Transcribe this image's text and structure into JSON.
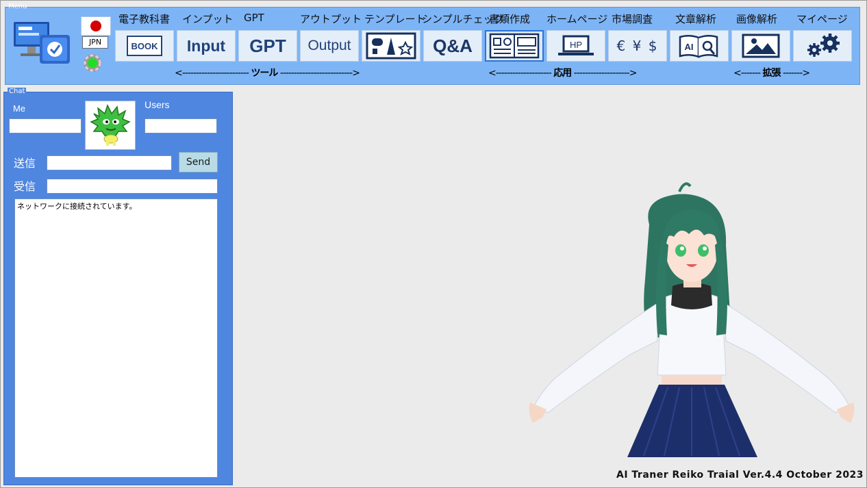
{
  "menu": {
    "group_title": "Menu",
    "language_button": "JPN",
    "tabs": [
      {
        "label": "電子教科書",
        "button": "BOOK",
        "icon": "book-icon"
      },
      {
        "label": "インプット",
        "button": "Input",
        "icon": "input-icon"
      },
      {
        "label": "GPT",
        "button": "GPT",
        "icon": "gpt-icon"
      },
      {
        "label": "アウトプット",
        "button": "Output",
        "icon": "output-icon"
      },
      {
        "label": "テンプレート",
        "button": "",
        "icon": "template-shapes-icon"
      },
      {
        "label": "シンプルチェック",
        "button": "Q&A",
        "icon": "qa-icon"
      },
      {
        "label": "書類作成",
        "button": "",
        "icon": "document-layout-icon"
      },
      {
        "label": "ホームページ",
        "button": "HP",
        "icon": "laptop-hp-icon"
      },
      {
        "label": "市場調査",
        "button": "€ ¥ $",
        "icon": "currency-icon"
      },
      {
        "label": "文章解析",
        "button": "AI",
        "icon": "ai-book-search-icon"
      },
      {
        "label": "画像解析",
        "button": "",
        "icon": "image-picture-icon"
      },
      {
        "label": "マイページ",
        "button": "",
        "icon": "gears-icon"
      }
    ],
    "sections": [
      {
        "left": "<------------------------ ",
        "label": "ツール",
        "right": " -------------------------->"
      },
      {
        "left": "<-------------------- ",
        "label": "応用",
        "right": " -------------------->"
      },
      {
        "left": "<------- ",
        "label": "拡張",
        "right": " ------->"
      }
    ]
  },
  "chat": {
    "group_title": "Chat",
    "me_label": "Me",
    "users_label": "Users",
    "send_label": "送信",
    "receive_label": "受信",
    "send_button": "Send",
    "me_value": "",
    "users_value": "",
    "send_value": "",
    "receive_value": "",
    "log": "ネットワークに接続されています。"
  },
  "status": {
    "connection": "connected",
    "indicator_color": "#22dd22"
  },
  "footer": {
    "version": "AI Traner Reiko Traial Ver.4.4 October 2023"
  }
}
